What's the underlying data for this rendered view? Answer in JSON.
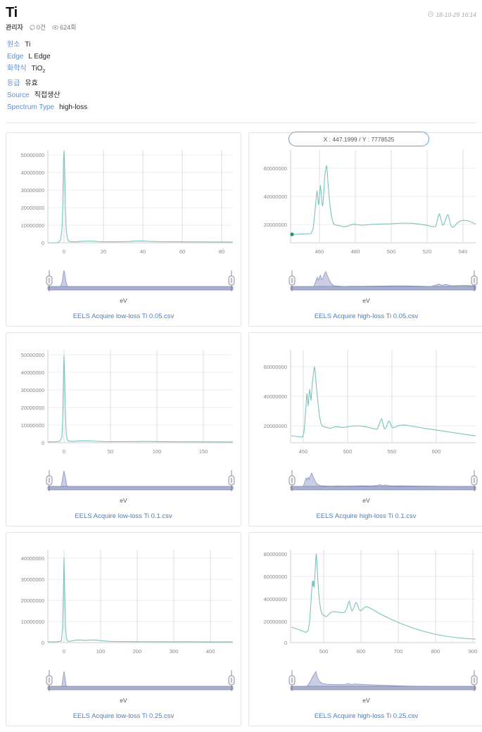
{
  "header": {
    "title": "Ti",
    "author": "관리자",
    "comment_count": "0건",
    "view_count": "624회",
    "timestamp": "18-10-29 16:14"
  },
  "fields": [
    {
      "key": "원소",
      "value": "Ti"
    },
    {
      "key": "Edge",
      "value": "L Edge"
    },
    {
      "key": "화학식",
      "value": "TiO2",
      "value_base": "TiO",
      "value_sub": "2"
    },
    {
      "key": "등급",
      "value": "유효"
    },
    {
      "key": "Source",
      "value": "직접생산"
    },
    {
      "key": "Spectrum Type",
      "value": "high-loss"
    }
  ],
  "axis_label": "eV",
  "tooltip": {
    "text": "X : 447.1999 / Y : 7778525"
  },
  "colors": {
    "link": "#4a7fc1",
    "field_key": "#5b8fd6",
    "spectrum": "#79c3bd",
    "brush": "#c9cee4",
    "tooltip_border": "#6c9bd2"
  },
  "chart_data": [
    {
      "id": "low-loss-005",
      "type": "line",
      "title": "EELS Acquire low-loss Ti 0.05.csv",
      "xlabel": "eV",
      "ylabel": "",
      "xticks": [
        0,
        20,
        40,
        60,
        80
      ],
      "yticks": [
        0,
        10000000,
        20000000,
        30000000,
        40000000,
        50000000
      ],
      "xlim": [
        -11,
        91
      ],
      "ylim": [
        -2000000,
        56000000
      ],
      "grid": true,
      "peak": {
        "x": 0,
        "y": 53000000
      },
      "description": "Zero-loss peak at 0 eV reaching ~53,000,000 counts, flat baseline near zero across 0-90 eV"
    },
    {
      "id": "high-loss-005",
      "type": "line",
      "title": "EELS Acquire high-loss Ti 0.05.csv",
      "xlabel": "eV",
      "ylabel": "",
      "xticks": [
        460,
        480,
        500,
        520,
        540
      ],
      "yticks": [
        20000000,
        40000000,
        60000000
      ],
      "xlim": [
        447,
        549
      ],
      "ylim": [
        2000000,
        72000000
      ],
      "grid": true,
      "cursor": {
        "x": 447.1999,
        "y": 7778525
      },
      "description": "Ti L-edge white lines: L3 ~458 eV and L2 ~464 eV multiplet peaks reaching ~67,000,000; plateau ~20,000,000 with O K-edge features at ~532 and ~537 eV"
    },
    {
      "id": "low-loss-01",
      "type": "line",
      "title": "EELS Acquire low-loss Ti 0.1.csv",
      "xlabel": "eV",
      "ylabel": "",
      "xticks": [
        0,
        50,
        100,
        150
      ],
      "yticks": [
        0,
        10000000,
        20000000,
        30000000,
        40000000,
        50000000
      ],
      "xlim": [
        -20,
        182
      ],
      "ylim": [
        -2000000,
        55000000
      ],
      "grid": true,
      "peak": {
        "x": 0,
        "y": 49500000
      },
      "description": "Zero-loss peak at 0 eV at ~49,500,000, flat baseline 0-180 eV"
    },
    {
      "id": "high-loss-01",
      "type": "line",
      "title": "EELS Acquire high-loss Ti 0.1.csv",
      "xlabel": "eV",
      "ylabel": "",
      "xticks": [
        450,
        500,
        550,
        600
      ],
      "yticks": [
        20000000,
        40000000,
        60000000
      ],
      "xlim": [
        435,
        640
      ],
      "ylim": [
        4000000,
        70000000
      ],
      "grid": true,
      "description": "Ti L23 white lines near 458-466 eV peaking ~65,000,000, decaying background from ~22,000,000 to ~16,000,000 by 640 eV, O K-edge at ~532 eV"
    },
    {
      "id": "low-loss-025",
      "type": "line",
      "title": "EELS Acquire low-loss Ti 0.25.csv",
      "xlabel": "eV",
      "ylabel": "",
      "xticks": [
        0,
        100,
        200,
        300,
        400
      ],
      "yticks": [
        0,
        10000000,
        20000000,
        30000000,
        40000000
      ],
      "xlim": [
        -50,
        460
      ],
      "ylim": [
        -2000000,
        44000000
      ],
      "grid": true,
      "peak": {
        "x": 0,
        "y": 41000000
      },
      "description": "Zero-loss peak at 0 eV at ~41,000,000, small plasmon bump 20-60 eV, flat to 450 eV"
    },
    {
      "id": "high-loss-025",
      "type": "line",
      "title": "EELS Acquire high-loss Ti 0.25.csv",
      "xlabel": "eV",
      "ylabel": "",
      "xticks": [
        500,
        600,
        700,
        800,
        900
      ],
      "yticks": [
        0,
        20000000,
        40000000,
        60000000,
        80000000
      ],
      "xlim": [
        410,
        905
      ],
      "ylim": [
        0,
        85000000
      ],
      "grid": true,
      "description": "Ti L-edge peak ~78,000,000 near 462 eV, O K-edge features 530-570 eV at ~30,000,000, long decaying tail to ~5,000,000 at 900 eV"
    }
  ]
}
